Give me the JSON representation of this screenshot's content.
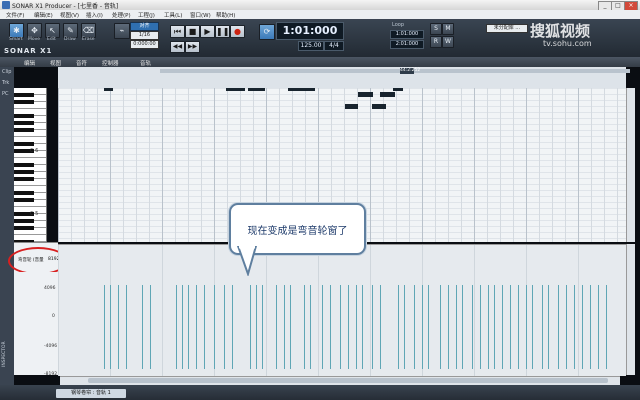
{
  "window": {
    "title": "SONAR X1 Producer - [七里香 - 音轨]",
    "min": "_",
    "max": "□",
    "close": "×"
  },
  "menu": [
    "文件(F)",
    "编辑(E)",
    "视图(V)",
    "插入(I)",
    "处理(P)",
    "工程(J)",
    "工具(L)",
    "窗口(W)",
    "帮助(H)"
  ],
  "controlbar": {
    "logo": "SONAR X1",
    "tools": [
      "Smart",
      "Move",
      "Edit",
      "Draw",
      "Erase"
    ],
    "snap_label": "对齐",
    "snap_value": "1/16",
    "snap_field": "0:000:00",
    "time": "1:01:000",
    "tempo": "125.00",
    "meter": "4/4",
    "loop_label": "Loop",
    "loop_start": "1:01:000",
    "loop_end": "2:01:000",
    "mix_label": "未分配库 …"
  },
  "editor": {
    "menus": [
      "编辑",
      "视图",
      "音符",
      "控制器",
      "音轨"
    ],
    "ruler_marker": "44:2:252"
  },
  "left_strip": [
    "Clip",
    "Trk",
    "PC"
  ],
  "inspector_label": "INSPECTOR",
  "keyboard": {
    "octaves": [
      "C 6",
      "C 5"
    ]
  },
  "controller": {
    "type_label": "弯音轮 (音量",
    "value_label": "8192",
    "ticks": [
      "4096",
      "0",
      "-4096",
      "-8192"
    ]
  },
  "callout": "现在变成是弯音轮窗了",
  "bottom_tab": "钢琴卷帘 : 音轨 1",
  "watermark": {
    "brand": "搜狐视频",
    "url": "tv.sohu.com"
  },
  "notes": [
    [
      111,
      122,
      9
    ],
    [
      118,
      130,
      9
    ],
    [
      140,
      170,
      9
    ],
    [
      178,
      194,
      9
    ],
    [
      190,
      210,
      15
    ],
    [
      212,
      228,
      15
    ],
    [
      104,
      113,
      27
    ],
    [
      226,
      245,
      27
    ],
    [
      248,
      265,
      27
    ],
    [
      268,
      280,
      21
    ],
    [
      288,
      315,
      27
    ],
    [
      315,
      335,
      21
    ],
    [
      330,
      345,
      24
    ],
    [
      345,
      358,
      36
    ],
    [
      358,
      373,
      30
    ],
    [
      372,
      386,
      36
    ],
    [
      380,
      395,
      30
    ],
    [
      393,
      403,
      27
    ],
    [
      404,
      420,
      9
    ],
    [
      418,
      432,
      15
    ],
    [
      432,
      465,
      9
    ],
    [
      460,
      480,
      15
    ],
    [
      478,
      500,
      9
    ],
    [
      498,
      510,
      15
    ],
    [
      506,
      520,
      3
    ],
    [
      512,
      527,
      9
    ],
    [
      526,
      540,
      9
    ],
    [
      540,
      552,
      15
    ],
    [
      550,
      575,
      9
    ],
    [
      574,
      594,
      15
    ],
    [
      594,
      614,
      21
    ]
  ],
  "bars": [
    [
      104,
      262
    ],
    [
      110,
      268
    ],
    [
      118,
      262
    ],
    [
      126,
      262
    ],
    [
      142,
      262
    ],
    [
      150,
      262
    ],
    [
      176,
      262
    ],
    [
      182,
      262
    ],
    [
      188,
      262
    ],
    [
      196,
      262
    ],
    [
      204,
      262
    ],
    [
      214,
      262
    ],
    [
      224,
      262
    ],
    [
      232,
      262
    ],
    [
      250,
      262
    ],
    [
      256,
      262
    ],
    [
      262,
      262
    ],
    [
      276,
      262
    ],
    [
      284,
      262
    ],
    [
      290,
      262
    ],
    [
      304,
      262
    ],
    [
      310,
      262
    ],
    [
      322,
      262
    ],
    [
      330,
      262
    ],
    [
      340,
      262
    ],
    [
      348,
      262
    ],
    [
      356,
      262
    ],
    [
      362,
      262
    ],
    [
      372,
      262
    ],
    [
      380,
      262
    ],
    [
      398,
      262
    ],
    [
      404,
      262
    ],
    [
      414,
      262
    ],
    [
      422,
      262
    ],
    [
      428,
      262
    ],
    [
      440,
      262
    ],
    [
      448,
      262
    ],
    [
      456,
      262
    ],
    [
      462,
      262
    ],
    [
      472,
      262
    ],
    [
      480,
      262
    ],
    [
      488,
      262
    ],
    [
      494,
      262
    ],
    [
      502,
      262
    ],
    [
      510,
      262
    ],
    [
      518,
      262
    ],
    [
      526,
      262
    ],
    [
      532,
      262
    ],
    [
      542,
      262
    ],
    [
      548,
      262
    ],
    [
      558,
      262
    ],
    [
      566,
      262
    ],
    [
      574,
      262
    ],
    [
      582,
      262
    ],
    [
      590,
      262
    ],
    [
      598,
      262
    ],
    [
      606,
      262
    ]
  ]
}
